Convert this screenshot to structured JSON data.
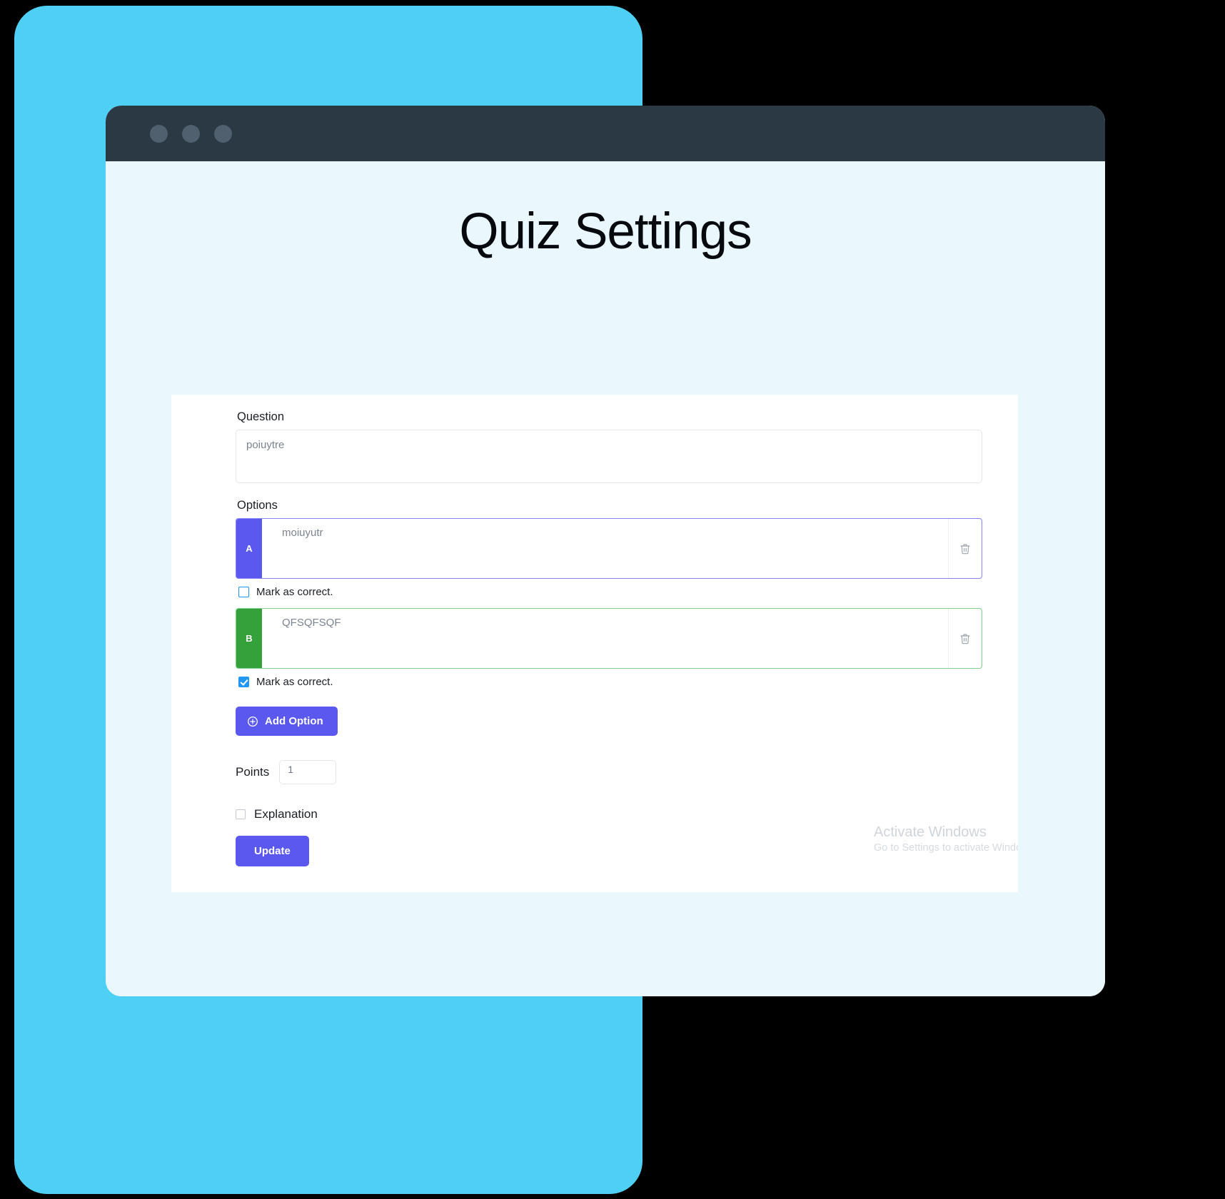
{
  "window": {
    "dots": [
      "dot-1",
      "dot-2",
      "dot-3"
    ],
    "titlebar_color": "#2b3945",
    "viewport_color": "#eaf8fd"
  },
  "backdrop": {
    "color": "#4ed0f5"
  },
  "page": {
    "title": "Quiz Settings"
  },
  "form": {
    "question": {
      "label": "Question",
      "value": "poiuytre"
    },
    "options": {
      "label": "Options",
      "items": [
        {
          "letter": "A",
          "value": "moiuyutr",
          "color": "#5b58f0",
          "border_color": "#8785f5",
          "mark_label": "Mark as correct.",
          "checked": false,
          "delete_icon": "trash-icon"
        },
        {
          "letter": "B",
          "value": "QFSQFSQF",
          "color": "#34a13b",
          "border_color": "#81d08b",
          "mark_label": "Mark as correct.",
          "checked": true,
          "delete_icon": "trash-icon"
        }
      ]
    },
    "add_option": {
      "label": "Add Option",
      "icon": "plus-circle-icon",
      "color": "#5b58f0"
    },
    "points": {
      "label": "Points",
      "value": "1"
    },
    "explanation": {
      "label": "Explanation",
      "checked": false
    },
    "update": {
      "label": "Update",
      "color": "#5b58f0"
    }
  },
  "watermark": {
    "title": "Activate Windows",
    "subtitle": "Go to Settings to activate Windows"
  }
}
